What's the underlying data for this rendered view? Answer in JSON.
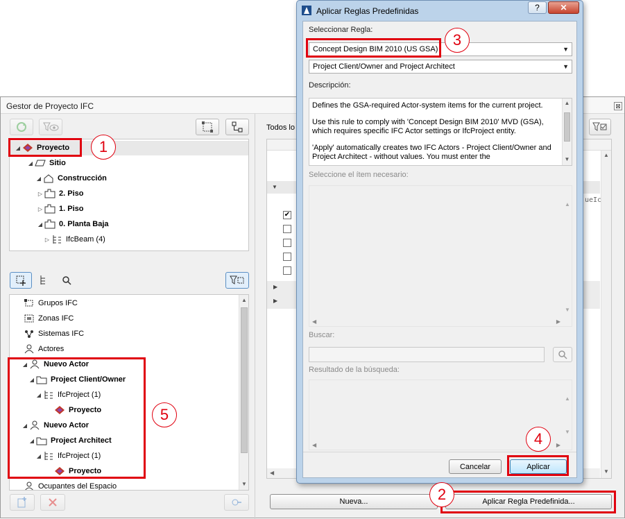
{
  "main_window": {
    "title": "Gestor de Proyecto IFC",
    "close_glyph": "⊠",
    "right_header_label": "Todos lo",
    "right_col_fragment": "ueIc",
    "tree_top": [
      {
        "label": "Proyecto",
        "bold": true,
        "icon": "ifc-project-icon"
      },
      {
        "label": "Sitio",
        "bold": true,
        "icon": "site-icon"
      },
      {
        "label": "Construcción",
        "bold": true,
        "icon": "building-icon"
      },
      {
        "label": "2. Piso",
        "bold": true,
        "icon": "storey-icon"
      },
      {
        "label": "1. Piso",
        "bold": true,
        "icon": "storey-icon"
      },
      {
        "label": "0. Planta Baja",
        "bold": true,
        "icon": "storey-icon"
      },
      {
        "label": "IfcBeam (4)",
        "bold": false,
        "icon": "ifc-entity-icon"
      }
    ],
    "tree_bottom": [
      {
        "label": "Grupos IFC",
        "bold": false,
        "icon": "group-icon"
      },
      {
        "label": "Zonas IFC",
        "bold": false,
        "icon": "zone-icon"
      },
      {
        "label": "Sistemas IFC",
        "bold": false,
        "icon": "system-icon"
      },
      {
        "label": "Actores",
        "bold": false,
        "icon": "actor-icon"
      },
      {
        "label": "Nuevo Actor",
        "bold": true,
        "icon": "actor-icon"
      },
      {
        "label": "Project Client/Owner",
        "bold": true,
        "icon": "folder-icon"
      },
      {
        "label": "IfcProject (1)",
        "bold": false,
        "icon": "ifc-entity-icon"
      },
      {
        "label": "Proyecto",
        "bold": true,
        "icon": "ifc-project-icon"
      },
      {
        "label": "Nuevo Actor",
        "bold": true,
        "icon": "actor-icon"
      },
      {
        "label": "Project Architect",
        "bold": true,
        "icon": "folder-icon"
      },
      {
        "label": "IfcProject (1)",
        "bold": false,
        "icon": "ifc-entity-icon"
      },
      {
        "label": "Proyecto",
        "bold": true,
        "icon": "ifc-project-icon"
      },
      {
        "label": "Ocupantes del Espacio",
        "bold": false,
        "icon": "actor-icon"
      }
    ],
    "buttons": {
      "nueva": "Nueva...",
      "apply_rule": "Aplicar Regla Predefinida..."
    },
    "checkboxes": [
      true,
      false,
      false,
      false,
      false
    ]
  },
  "dialog": {
    "title": "Aplicar Reglas Predefinidas",
    "help_glyph": "?",
    "close_glyph": "✕",
    "select_rule_label": "Seleccionar Regla:",
    "rule_value": "Concept Design BIM 2010 (US GSA)",
    "sub_rule_value": "Project Client/Owner and Project Architect",
    "description_label": "Descripción:",
    "description": [
      "Defines the GSA-required Actor-system items for the current project.",
      "Use this rule to comply with 'Concept Design BIM 2010' MVD (GSA), which requires specific IFC Actor settings or IfcProject entity.",
      "'Apply' automatically creates two IFC Actors - Project Client/Owner and Project Architect - without values. You must enter the"
    ],
    "select_item_label": "Seleccione el ítem necesario:",
    "search_label": "Buscar:",
    "search_value": "",
    "result_label": "Resultado de la búsqueda:",
    "cancel_label": "Cancelar",
    "apply_label": "Aplicar"
  },
  "callouts": [
    "1",
    "2",
    "3",
    "4",
    "5"
  ],
  "colors": {
    "annotation_red": "#e0000f",
    "dialog_frame": "#bcd3ea",
    "window_bg": "#f0f0f0"
  }
}
